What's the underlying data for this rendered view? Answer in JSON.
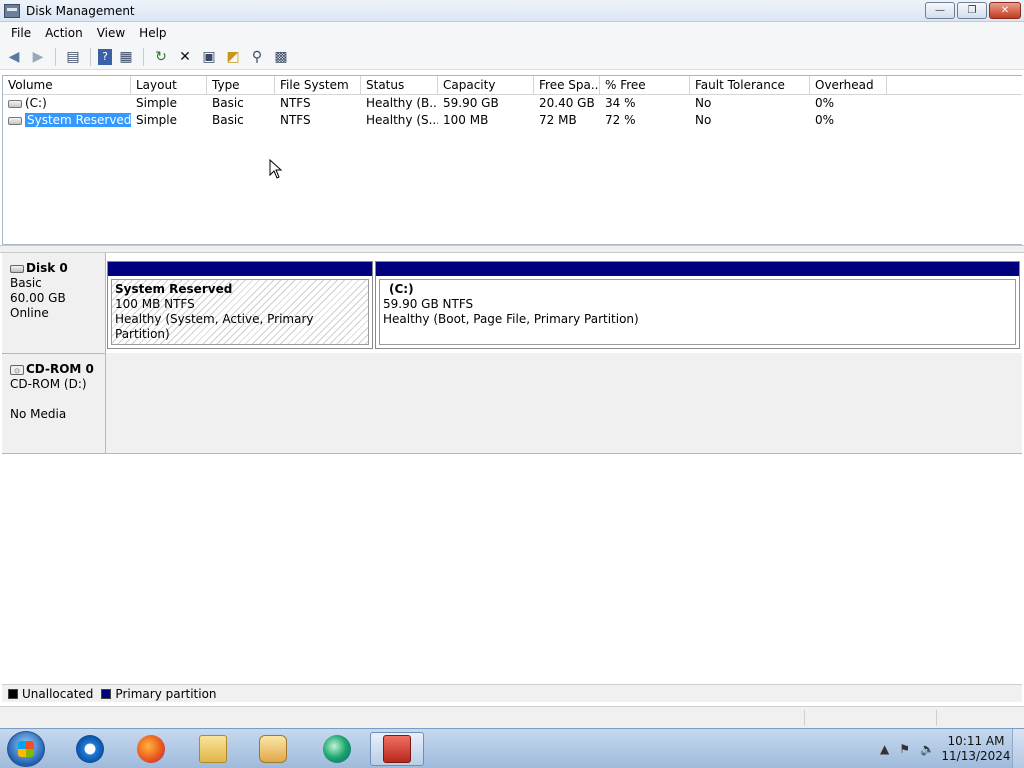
{
  "window": {
    "title": "Disk Management",
    "icon": "disk-management-icon"
  },
  "menu": [
    "File",
    "Action",
    "View",
    "Help"
  ],
  "toolbar_icons": [
    "back-arrow-icon",
    "forward-arrow-icon",
    "console-icon",
    "help-icon",
    "properties-pane-icon",
    "refresh-icon",
    "delete-icon",
    "properties-icon",
    "open-icon",
    "explore-icon",
    "manage-icon"
  ],
  "volume_list": {
    "columns": [
      "Volume",
      "Layout",
      "Type",
      "File System",
      "Status",
      "Capacity",
      "Free Spa...",
      "% Free",
      "Fault Tolerance",
      "Overhead"
    ],
    "rows": [
      [
        "(C:)",
        "Simple",
        "Basic",
        "NTFS",
        "Healthy (B...",
        "59.90 GB",
        "20.40 GB",
        "34 %",
        "No",
        "0%"
      ],
      [
        "System Reserved",
        "Simple",
        "Basic",
        "NTFS",
        "Healthy (S...",
        "100 MB",
        "72 MB",
        "72 %",
        "No",
        "0%"
      ]
    ],
    "selected_row": 1
  },
  "disks": [
    {
      "name": "Disk 0",
      "type": "Basic",
      "size": "60.00 GB",
      "state": "Online",
      "partitions": [
        {
          "name": "System Reserved",
          "size": "100 MB NTFS",
          "status": "Healthy (System, Active, Primary Partition)"
        },
        {
          "name": "(C:)",
          "size": "59.90 GB NTFS",
          "status": "Healthy (Boot, Page File, Primary Partition)"
        }
      ]
    },
    {
      "name": "CD-ROM 0",
      "type": "CD-ROM (D:)",
      "state": "No Media"
    }
  ],
  "legend": [
    {
      "label": "Unallocated",
      "color": "#000000"
    },
    {
      "label": "Primary partition",
      "color": "#00007f"
    }
  ],
  "taskbar": {
    "apps": [
      "internet-explorer-icon",
      "firefox-icon",
      "file-explorer-icon",
      "media-player-icon",
      "browser-icon",
      "computer-management-icon"
    ],
    "clock_time": "10:11 AM",
    "clock_date": "11/13/2024"
  }
}
